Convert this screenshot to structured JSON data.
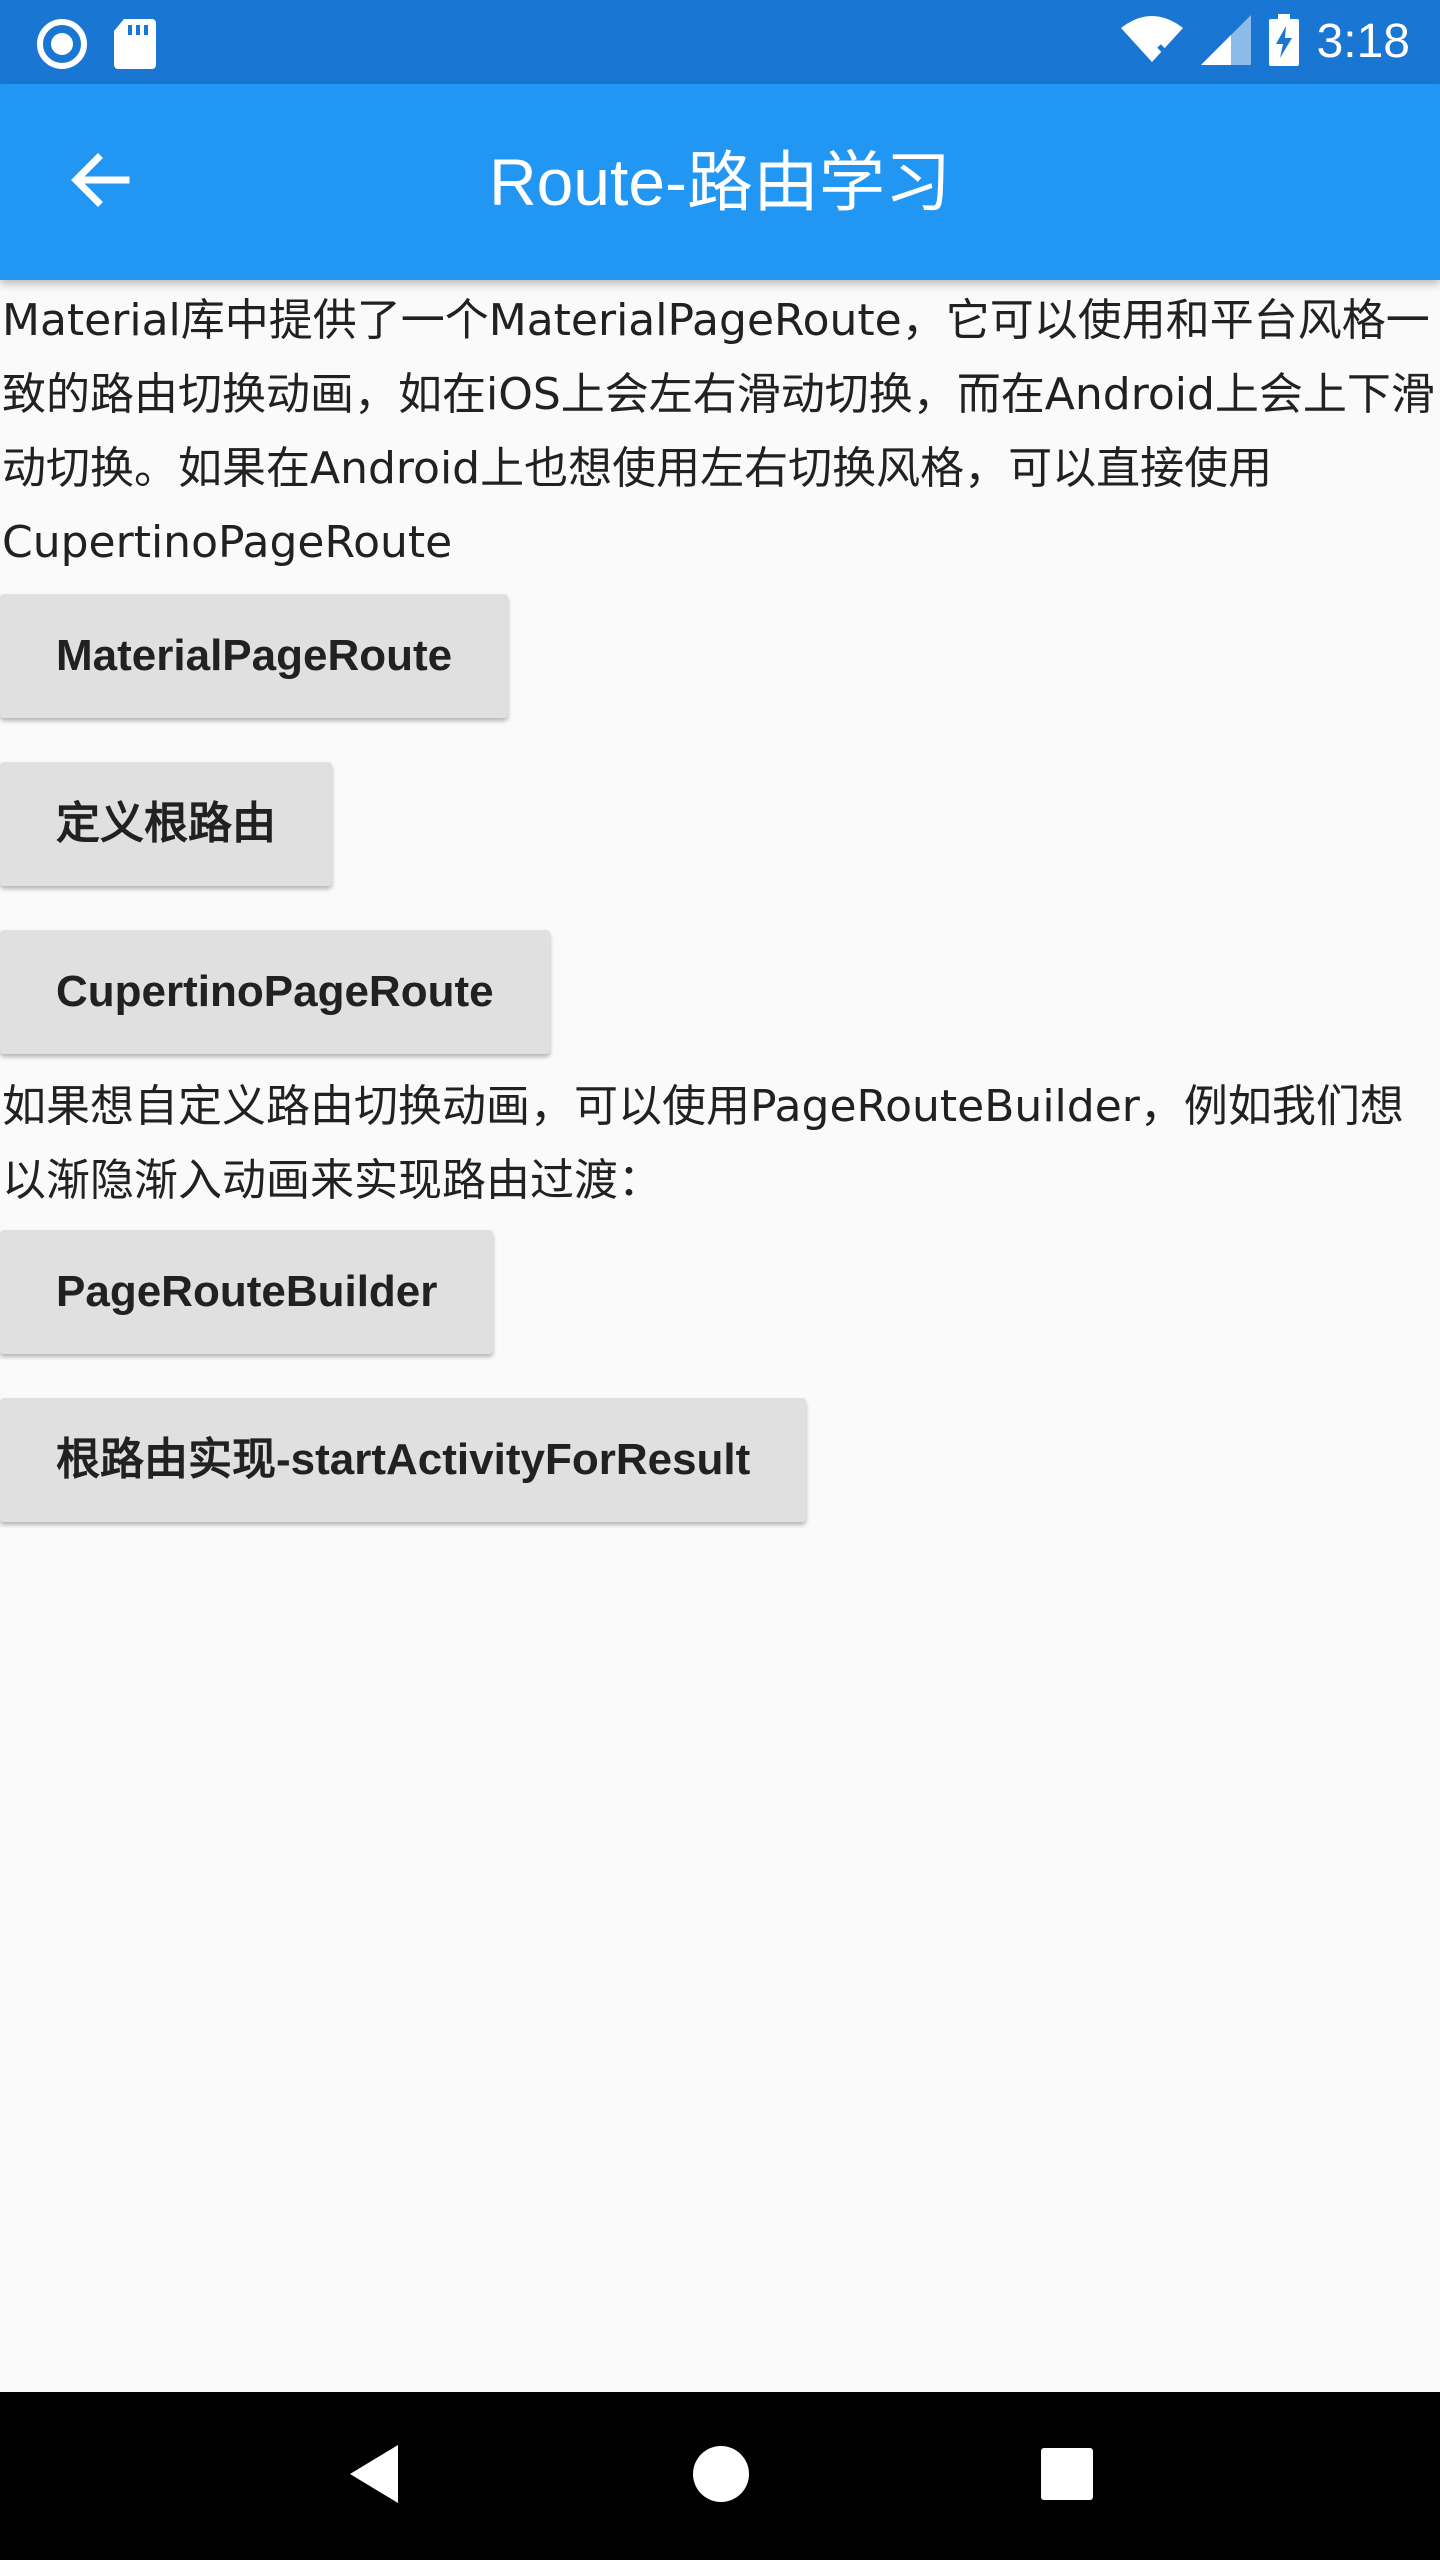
{
  "status_bar": {
    "time": "3:18",
    "icons": [
      "record-icon",
      "sd-card-icon",
      "wifi-off-icon",
      "signal-icon",
      "battery-charging-icon"
    ]
  },
  "app_bar": {
    "title": "Route-路由学习",
    "back_icon": "arrow-back-icon"
  },
  "main": {
    "intro_text": "Material库中提供了一个MaterialPageRoute，它可以使用和平台风格一致的路由切换动画，如在iOS上会左右滑动切换，而在Android上会上下滑动切换。如果在Android上也想使用左右切换风格，可以直接使用CupertinoPageRoute",
    "buttons_group1": [
      "MaterialPageRoute",
      "定义根路由",
      "CupertinoPageRoute"
    ],
    "custom_text": "如果想自定义路由切换动画，可以使用PageRouteBuilder，例如我们想以渐隐渐入动画来实现路由过渡：",
    "buttons_group2": [
      "PageRouteBuilder",
      "根路由实现-startActivityForResult"
    ]
  },
  "nav_bar": {
    "icons": [
      "back-triangle-icon",
      "home-circle-icon",
      "recents-square-icon"
    ]
  },
  "colors": {
    "status_bar": "#1976d2",
    "app_bar": "#2196f3",
    "background": "#fafafa",
    "button": "#e0e0e0"
  }
}
